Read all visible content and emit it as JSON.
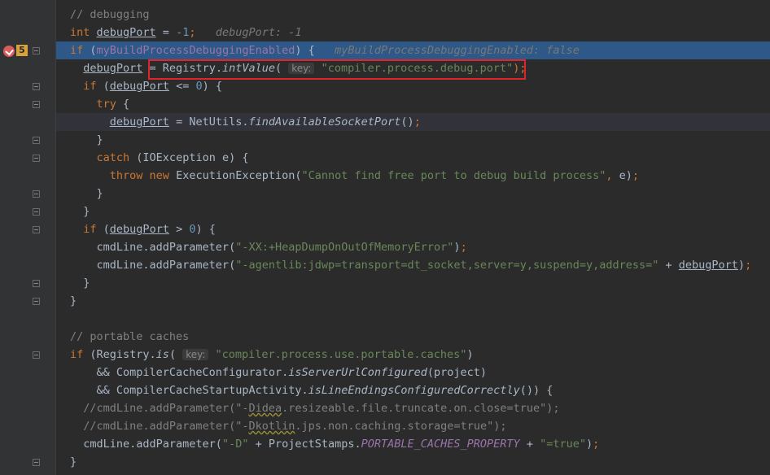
{
  "gutter": {
    "breakpoint_count": "5"
  },
  "lines": [
    {
      "tokens": [
        {
          "t": "// debugging",
          "c": "cmt"
        }
      ]
    },
    {
      "tokens": [
        {
          "t": "int ",
          "c": "kw"
        },
        {
          "t": "debugPort",
          "c": "ul"
        },
        {
          "t": " = "
        },
        {
          "t": "-1",
          "c": "num"
        },
        {
          "t": ";",
          "c": "kw"
        },
        {
          "t": "   debugPort: -1",
          "c": "inline-hint"
        }
      ]
    },
    {
      "tokens": [
        {
          "t": "if ",
          "c": "kw"
        },
        {
          "t": "("
        },
        {
          "t": "myBuildProcessDebuggingEnabled",
          "c": "field"
        },
        {
          "t": ") {"
        },
        {
          "t": "   myBuildProcessDebuggingEnabled: false",
          "c": "inline-hint"
        }
      ]
    },
    {
      "tokens": [
        {
          "t": "  "
        },
        {
          "t": "debugPort",
          "c": "ul"
        },
        {
          "t": " = Registry."
        },
        {
          "t": "intValue",
          "c": "meth-it"
        },
        {
          "t": "( "
        },
        {
          "t": "key:",
          "c": "param-hint"
        },
        {
          "t": " "
        },
        {
          "t": "\"compiler.process.debug.port\"",
          "c": "str"
        },
        {
          "t": ");",
          "c": "kw"
        }
      ]
    },
    {
      "tokens": [
        {
          "t": "  "
        },
        {
          "t": "if ",
          "c": "kw"
        },
        {
          "t": "("
        },
        {
          "t": "debugPort",
          "c": "ul"
        },
        {
          "t": " <= "
        },
        {
          "t": "0",
          "c": "num"
        },
        {
          "t": ") {"
        }
      ]
    },
    {
      "tokens": [
        {
          "t": "    "
        },
        {
          "t": "try ",
          "c": "kw"
        },
        {
          "t": "{"
        }
      ]
    },
    {
      "tokens": [
        {
          "t": "      "
        },
        {
          "t": "debugPort",
          "c": "ul"
        },
        {
          "t": " = NetUtils."
        },
        {
          "t": "findAvailableSocketPort",
          "c": "meth-it"
        },
        {
          "t": "()"
        },
        {
          "t": ";",
          "c": "kw"
        }
      ]
    },
    {
      "tokens": [
        {
          "t": "    }"
        }
      ]
    },
    {
      "tokens": [
        {
          "t": "    "
        },
        {
          "t": "catch ",
          "c": "kw"
        },
        {
          "t": "(IOException e) {"
        }
      ]
    },
    {
      "tokens": [
        {
          "t": "      "
        },
        {
          "t": "throw new ",
          "c": "kw"
        },
        {
          "t": "ExecutionException("
        },
        {
          "t": "\"Cannot find free port to debug build process\"",
          "c": "str"
        },
        {
          "t": ", ",
          "c": "kw"
        },
        {
          "t": "e)"
        },
        {
          "t": ";",
          "c": "kw"
        }
      ]
    },
    {
      "tokens": [
        {
          "t": "    }"
        }
      ]
    },
    {
      "tokens": [
        {
          "t": "  }"
        }
      ]
    },
    {
      "tokens": [
        {
          "t": "  "
        },
        {
          "t": "if ",
          "c": "kw"
        },
        {
          "t": "("
        },
        {
          "t": "debugPort",
          "c": "ul"
        },
        {
          "t": " > "
        },
        {
          "t": "0",
          "c": "num"
        },
        {
          "t": ") {"
        }
      ]
    },
    {
      "tokens": [
        {
          "t": "    cmdLine.addParameter("
        },
        {
          "t": "\"-XX:+HeapDumpOnOutOfMemoryError\"",
          "c": "str"
        },
        {
          "t": ")"
        },
        {
          "t": ";",
          "c": "kw"
        }
      ]
    },
    {
      "tokens": [
        {
          "t": "    cmdLine.addParameter("
        },
        {
          "t": "\"-agentlib:jdwp=transport=dt_socket,server=y,suspend=y,address=\"",
          "c": "str"
        },
        {
          "t": " + "
        },
        {
          "t": "debugPort",
          "c": "ul"
        },
        {
          "t": ")"
        },
        {
          "t": ";",
          "c": "kw"
        }
      ]
    },
    {
      "tokens": [
        {
          "t": "  }"
        }
      ]
    },
    {
      "tokens": [
        {
          "t": "}"
        }
      ]
    },
    {
      "tokens": []
    },
    {
      "tokens": [
        {
          "t": "// portable caches",
          "c": "cmt"
        }
      ]
    },
    {
      "tokens": [
        {
          "t": "if ",
          "c": "kw"
        },
        {
          "t": "(Registry."
        },
        {
          "t": "is",
          "c": "meth-it"
        },
        {
          "t": "( "
        },
        {
          "t": "key:",
          "c": "param-hint"
        },
        {
          "t": " "
        },
        {
          "t": "\"compiler.process.use.portable.caches\"",
          "c": "str"
        },
        {
          "t": ")"
        }
      ]
    },
    {
      "tokens": [
        {
          "t": "    && CompilerCacheConfigurator."
        },
        {
          "t": "isServerUrlConfigured",
          "c": "meth-it"
        },
        {
          "t": "(project)"
        }
      ]
    },
    {
      "tokens": [
        {
          "t": "    && CompilerCacheStartupActivity."
        },
        {
          "t": "isLineEndingsConfiguredCorrectly",
          "c": "meth-it"
        },
        {
          "t": "()) {"
        }
      ]
    },
    {
      "tokens": [
        {
          "t": "  "
        },
        {
          "t": "//cmdLine.addParameter(\"-",
          "c": "cmt"
        },
        {
          "t": "Didea",
          "c": "cmt squig"
        },
        {
          "t": ".resizeable.file.truncate.on.close=true\");",
          "c": "cmt"
        }
      ]
    },
    {
      "tokens": [
        {
          "t": "  "
        },
        {
          "t": "//cmdLine.addParameter(\"-",
          "c": "cmt"
        },
        {
          "t": "Dkotlin",
          "c": "cmt squig"
        },
        {
          "t": ".jps.non.caching.storage=true\");",
          "c": "cmt"
        }
      ]
    },
    {
      "tokens": [
        {
          "t": "  cmdLine.addParameter("
        },
        {
          "t": "\"-D\"",
          "c": "str"
        },
        {
          "t": " + ProjectStamps."
        },
        {
          "t": "PORTABLE_CACHES_PROPERTY",
          "c": "field-it"
        },
        {
          "t": " + "
        },
        {
          "t": "\"=true\"",
          "c": "str"
        },
        {
          "t": ")"
        },
        {
          "t": ";",
          "c": "kw"
        }
      ]
    },
    {
      "tokens": [
        {
          "t": "}"
        }
      ]
    }
  ]
}
